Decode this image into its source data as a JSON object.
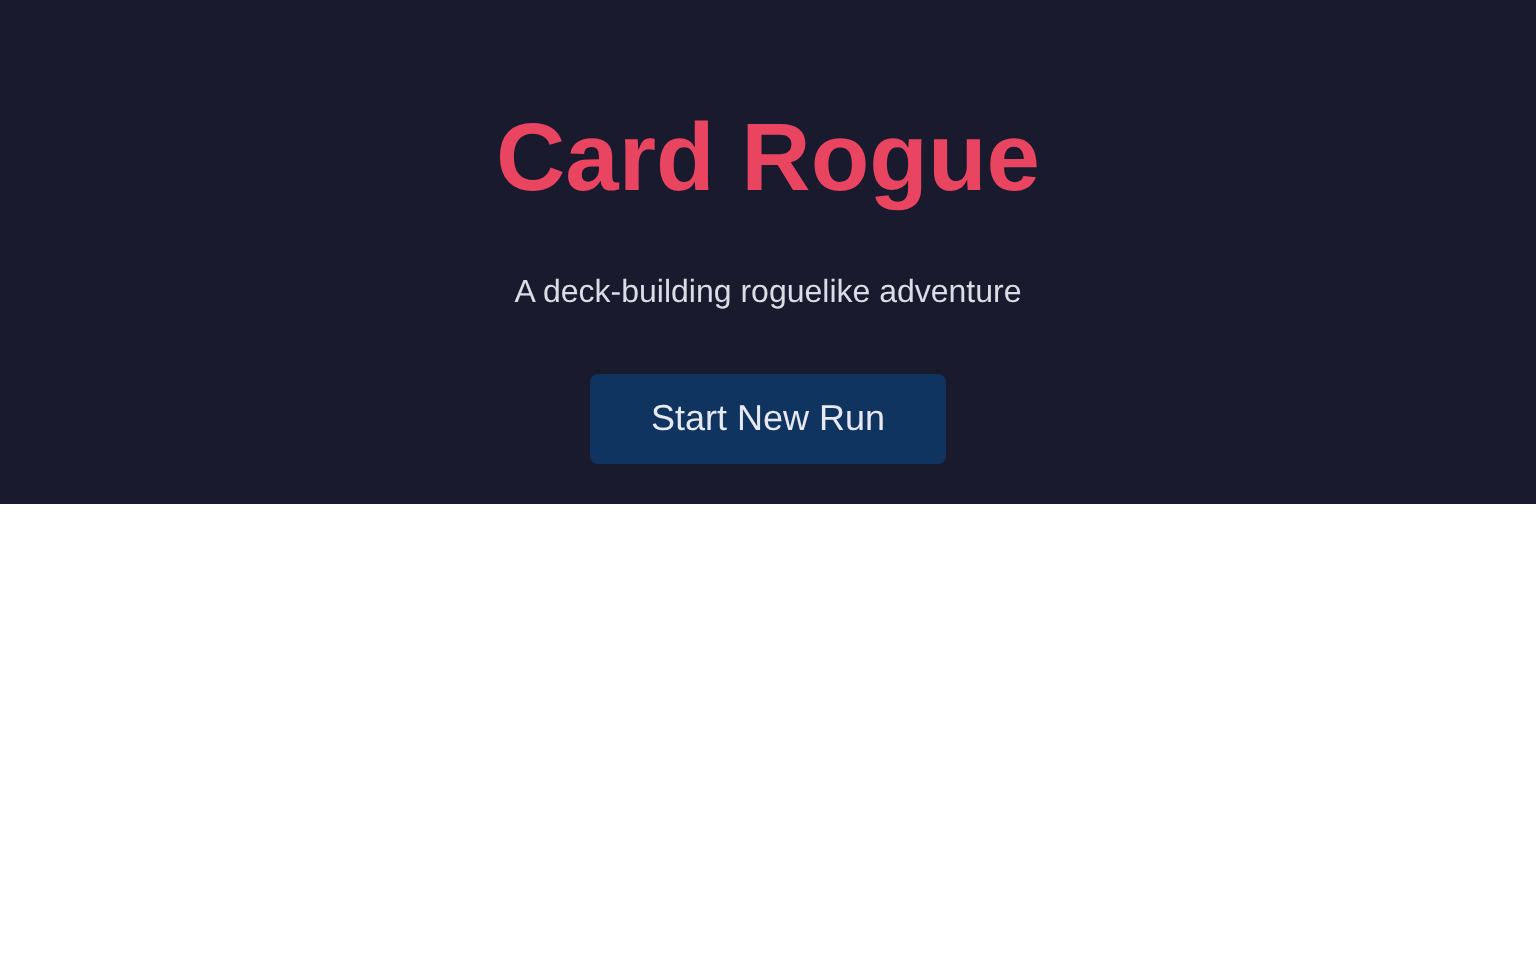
{
  "title": "Card Rogue",
  "subtitle": "A deck-building roguelike adventure",
  "start_button": "Start New Run"
}
